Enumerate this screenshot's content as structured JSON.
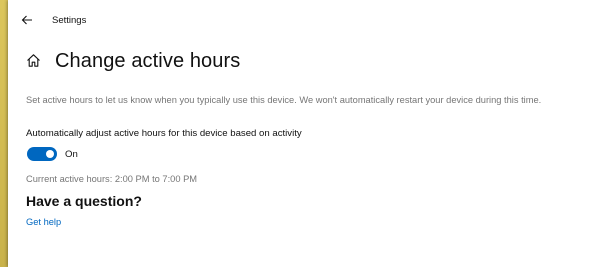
{
  "window": {
    "title": "Settings"
  },
  "page": {
    "title": "Change active hours",
    "description": "Set active hours to let us know when you typically use this device. We won't automatically restart your device during this time."
  },
  "auto_adjust": {
    "label": "Automatically adjust active hours for this device based on activity",
    "state_label": "On",
    "enabled": true
  },
  "current_hours": {
    "text": "Current active hours: 2:00 PM to 7:00 PM"
  },
  "help": {
    "heading": "Have a question?",
    "link": "Get help"
  },
  "colors": {
    "accent": "#0067c0",
    "secondary_text": "#767676",
    "desktop": "#d8c25a"
  },
  "icons": {
    "back": "back-arrow-icon",
    "home": "home-icon"
  }
}
